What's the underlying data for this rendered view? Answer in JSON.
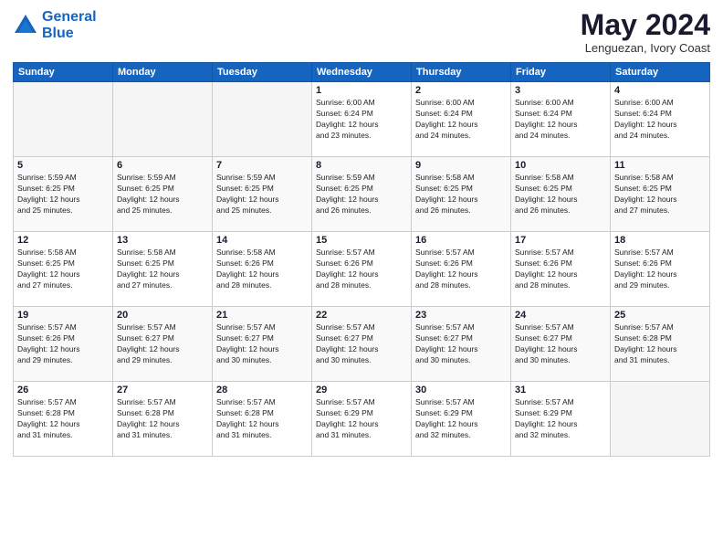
{
  "header": {
    "logo_line1": "General",
    "logo_line2": "Blue",
    "month_year": "May 2024",
    "location": "Lenguezan, Ivory Coast"
  },
  "weekdays": [
    "Sunday",
    "Monday",
    "Tuesday",
    "Wednesday",
    "Thursday",
    "Friday",
    "Saturday"
  ],
  "weeks": [
    [
      {
        "day": "",
        "info": ""
      },
      {
        "day": "",
        "info": ""
      },
      {
        "day": "",
        "info": ""
      },
      {
        "day": "1",
        "info": "Sunrise: 6:00 AM\nSunset: 6:24 PM\nDaylight: 12 hours\nand 23 minutes."
      },
      {
        "day": "2",
        "info": "Sunrise: 6:00 AM\nSunset: 6:24 PM\nDaylight: 12 hours\nand 24 minutes."
      },
      {
        "day": "3",
        "info": "Sunrise: 6:00 AM\nSunset: 6:24 PM\nDaylight: 12 hours\nand 24 minutes."
      },
      {
        "day": "4",
        "info": "Sunrise: 6:00 AM\nSunset: 6:24 PM\nDaylight: 12 hours\nand 24 minutes."
      }
    ],
    [
      {
        "day": "5",
        "info": "Sunrise: 5:59 AM\nSunset: 6:25 PM\nDaylight: 12 hours\nand 25 minutes."
      },
      {
        "day": "6",
        "info": "Sunrise: 5:59 AM\nSunset: 6:25 PM\nDaylight: 12 hours\nand 25 minutes."
      },
      {
        "day": "7",
        "info": "Sunrise: 5:59 AM\nSunset: 6:25 PM\nDaylight: 12 hours\nand 25 minutes."
      },
      {
        "day": "8",
        "info": "Sunrise: 5:59 AM\nSunset: 6:25 PM\nDaylight: 12 hours\nand 26 minutes."
      },
      {
        "day": "9",
        "info": "Sunrise: 5:58 AM\nSunset: 6:25 PM\nDaylight: 12 hours\nand 26 minutes."
      },
      {
        "day": "10",
        "info": "Sunrise: 5:58 AM\nSunset: 6:25 PM\nDaylight: 12 hours\nand 26 minutes."
      },
      {
        "day": "11",
        "info": "Sunrise: 5:58 AM\nSunset: 6:25 PM\nDaylight: 12 hours\nand 27 minutes."
      }
    ],
    [
      {
        "day": "12",
        "info": "Sunrise: 5:58 AM\nSunset: 6:25 PM\nDaylight: 12 hours\nand 27 minutes."
      },
      {
        "day": "13",
        "info": "Sunrise: 5:58 AM\nSunset: 6:25 PM\nDaylight: 12 hours\nand 27 minutes."
      },
      {
        "day": "14",
        "info": "Sunrise: 5:58 AM\nSunset: 6:26 PM\nDaylight: 12 hours\nand 28 minutes."
      },
      {
        "day": "15",
        "info": "Sunrise: 5:57 AM\nSunset: 6:26 PM\nDaylight: 12 hours\nand 28 minutes."
      },
      {
        "day": "16",
        "info": "Sunrise: 5:57 AM\nSunset: 6:26 PM\nDaylight: 12 hours\nand 28 minutes."
      },
      {
        "day": "17",
        "info": "Sunrise: 5:57 AM\nSunset: 6:26 PM\nDaylight: 12 hours\nand 28 minutes."
      },
      {
        "day": "18",
        "info": "Sunrise: 5:57 AM\nSunset: 6:26 PM\nDaylight: 12 hours\nand 29 minutes."
      }
    ],
    [
      {
        "day": "19",
        "info": "Sunrise: 5:57 AM\nSunset: 6:26 PM\nDaylight: 12 hours\nand 29 minutes."
      },
      {
        "day": "20",
        "info": "Sunrise: 5:57 AM\nSunset: 6:27 PM\nDaylight: 12 hours\nand 29 minutes."
      },
      {
        "day": "21",
        "info": "Sunrise: 5:57 AM\nSunset: 6:27 PM\nDaylight: 12 hours\nand 30 minutes."
      },
      {
        "day": "22",
        "info": "Sunrise: 5:57 AM\nSunset: 6:27 PM\nDaylight: 12 hours\nand 30 minutes."
      },
      {
        "day": "23",
        "info": "Sunrise: 5:57 AM\nSunset: 6:27 PM\nDaylight: 12 hours\nand 30 minutes."
      },
      {
        "day": "24",
        "info": "Sunrise: 5:57 AM\nSunset: 6:27 PM\nDaylight: 12 hours\nand 30 minutes."
      },
      {
        "day": "25",
        "info": "Sunrise: 5:57 AM\nSunset: 6:28 PM\nDaylight: 12 hours\nand 31 minutes."
      }
    ],
    [
      {
        "day": "26",
        "info": "Sunrise: 5:57 AM\nSunset: 6:28 PM\nDaylight: 12 hours\nand 31 minutes."
      },
      {
        "day": "27",
        "info": "Sunrise: 5:57 AM\nSunset: 6:28 PM\nDaylight: 12 hours\nand 31 minutes."
      },
      {
        "day": "28",
        "info": "Sunrise: 5:57 AM\nSunset: 6:28 PM\nDaylight: 12 hours\nand 31 minutes."
      },
      {
        "day": "29",
        "info": "Sunrise: 5:57 AM\nSunset: 6:29 PM\nDaylight: 12 hours\nand 31 minutes."
      },
      {
        "day": "30",
        "info": "Sunrise: 5:57 AM\nSunset: 6:29 PM\nDaylight: 12 hours\nand 32 minutes."
      },
      {
        "day": "31",
        "info": "Sunrise: 5:57 AM\nSunset: 6:29 PM\nDaylight: 12 hours\nand 32 minutes."
      },
      {
        "day": "",
        "info": ""
      }
    ]
  ]
}
